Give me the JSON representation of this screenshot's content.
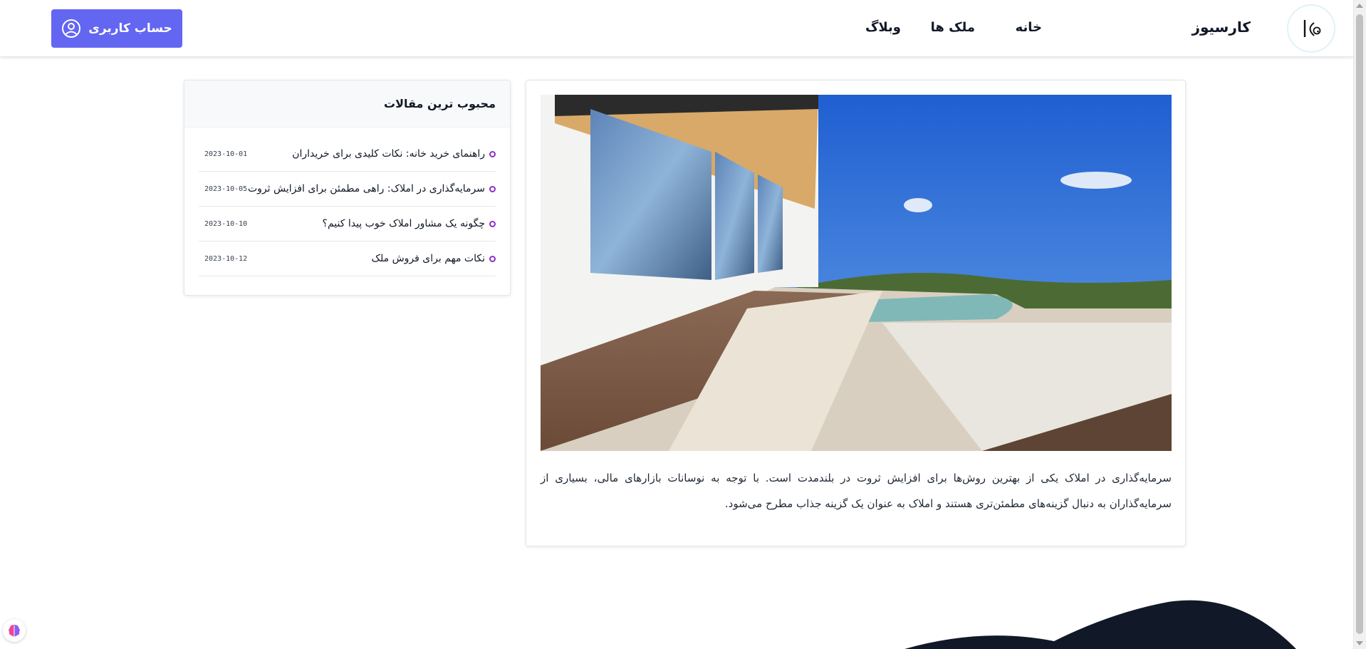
{
  "header": {
    "brand": "کارسیوز",
    "logo_letter": "k",
    "nav": {
      "home": "خانه",
      "properties": "ملک ها",
      "blog": "وبلاگ"
    },
    "account_button": "حساب کاربری"
  },
  "sidebar": {
    "title": "محبوب ترین مقالات",
    "items": [
      {
        "title": "راهنمای خرید خانه: نکات کلیدی برای خریداران",
        "date": "2023-10-01"
      },
      {
        "title": "سرمایه‌گذاری در املاک: راهی مطمئن برای افزایش ثروت",
        "date": "2023-10-05"
      },
      {
        "title": "چگونه یک مشاور املاک خوب پیدا کنیم؟",
        "date": "2023-10-10"
      },
      {
        "title": "نکات مهم برای فروش ملک",
        "date": "2023-10-12"
      }
    ]
  },
  "article": {
    "text": "سرمایه‌گذاری در املاک یکی از بهترین روش‌ها برای افزایش ثروت در بلندمدت است. با توجه به نوسانات بازارهای مالی، بسیاری از سرمایه‌گذاران به دنبال گزینه‌های مطمئن‌تری هستند و املاک به عنوان یک گزینه جذاب مطرح می‌شود."
  },
  "colors": {
    "accent": "#6366f1",
    "bullet": "#8b2fc9",
    "footer_wave": "#111827"
  },
  "icons": {
    "account": "user-circle-icon",
    "logo": "logo-icon",
    "widget": "brain-icon"
  }
}
